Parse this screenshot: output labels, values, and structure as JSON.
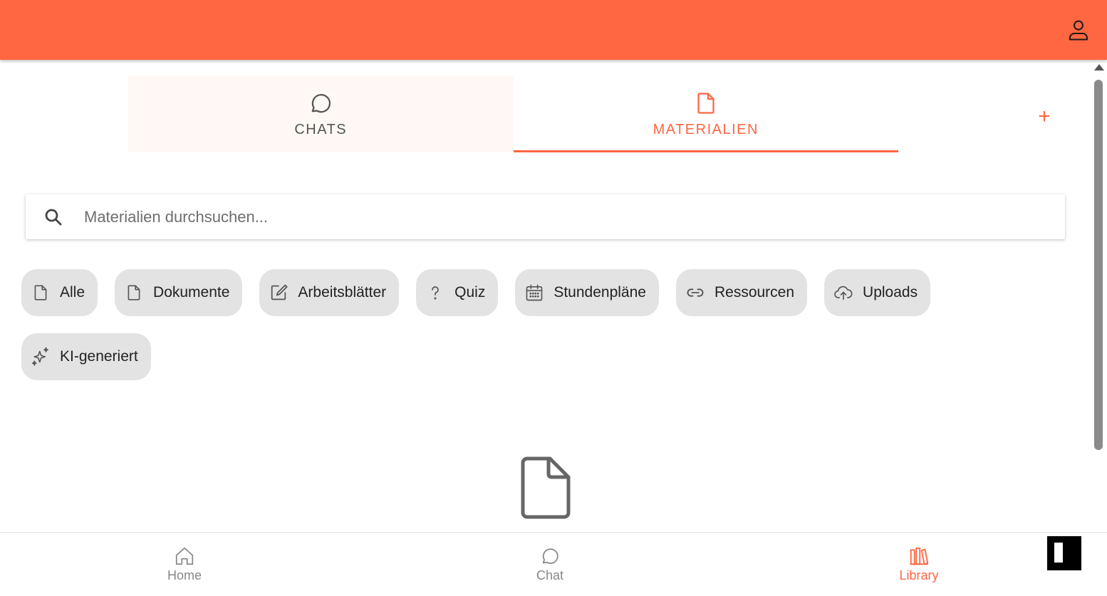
{
  "header": {
    "account_icon": "user-icon",
    "accent_color": "#ff6642"
  },
  "tabs": [
    {
      "label": "CHATS",
      "icon": "chat-bubble-icon",
      "active": false
    },
    {
      "label": "MATERIALIEN",
      "icon": "document-icon",
      "active": true
    }
  ],
  "add_button": {
    "label": "+"
  },
  "search": {
    "placeholder": "Materialien durchsuchen...",
    "value": "",
    "icon": "search-icon"
  },
  "filters": [
    {
      "label": "Alle",
      "icon": "document-icon"
    },
    {
      "label": "Dokumente",
      "icon": "document-icon"
    },
    {
      "label": "Arbeitsblätter",
      "icon": "edit-icon"
    },
    {
      "label": "Quiz",
      "icon": "question-icon"
    },
    {
      "label": "Stundenpläne",
      "icon": "calendar-icon"
    },
    {
      "label": "Ressourcen",
      "icon": "link-icon"
    },
    {
      "label": "Uploads",
      "icon": "cloud-upload-icon"
    },
    {
      "label": "KI-generiert",
      "icon": "sparkles-icon"
    }
  ],
  "empty_state": {
    "icon": "document-icon"
  },
  "bottom_nav": [
    {
      "label": "Home",
      "icon": "home-icon",
      "active": false
    },
    {
      "label": "Chat",
      "icon": "chat-bubble-icon",
      "active": false
    },
    {
      "label": "Library",
      "icon": "library-icon",
      "active": true
    }
  ]
}
